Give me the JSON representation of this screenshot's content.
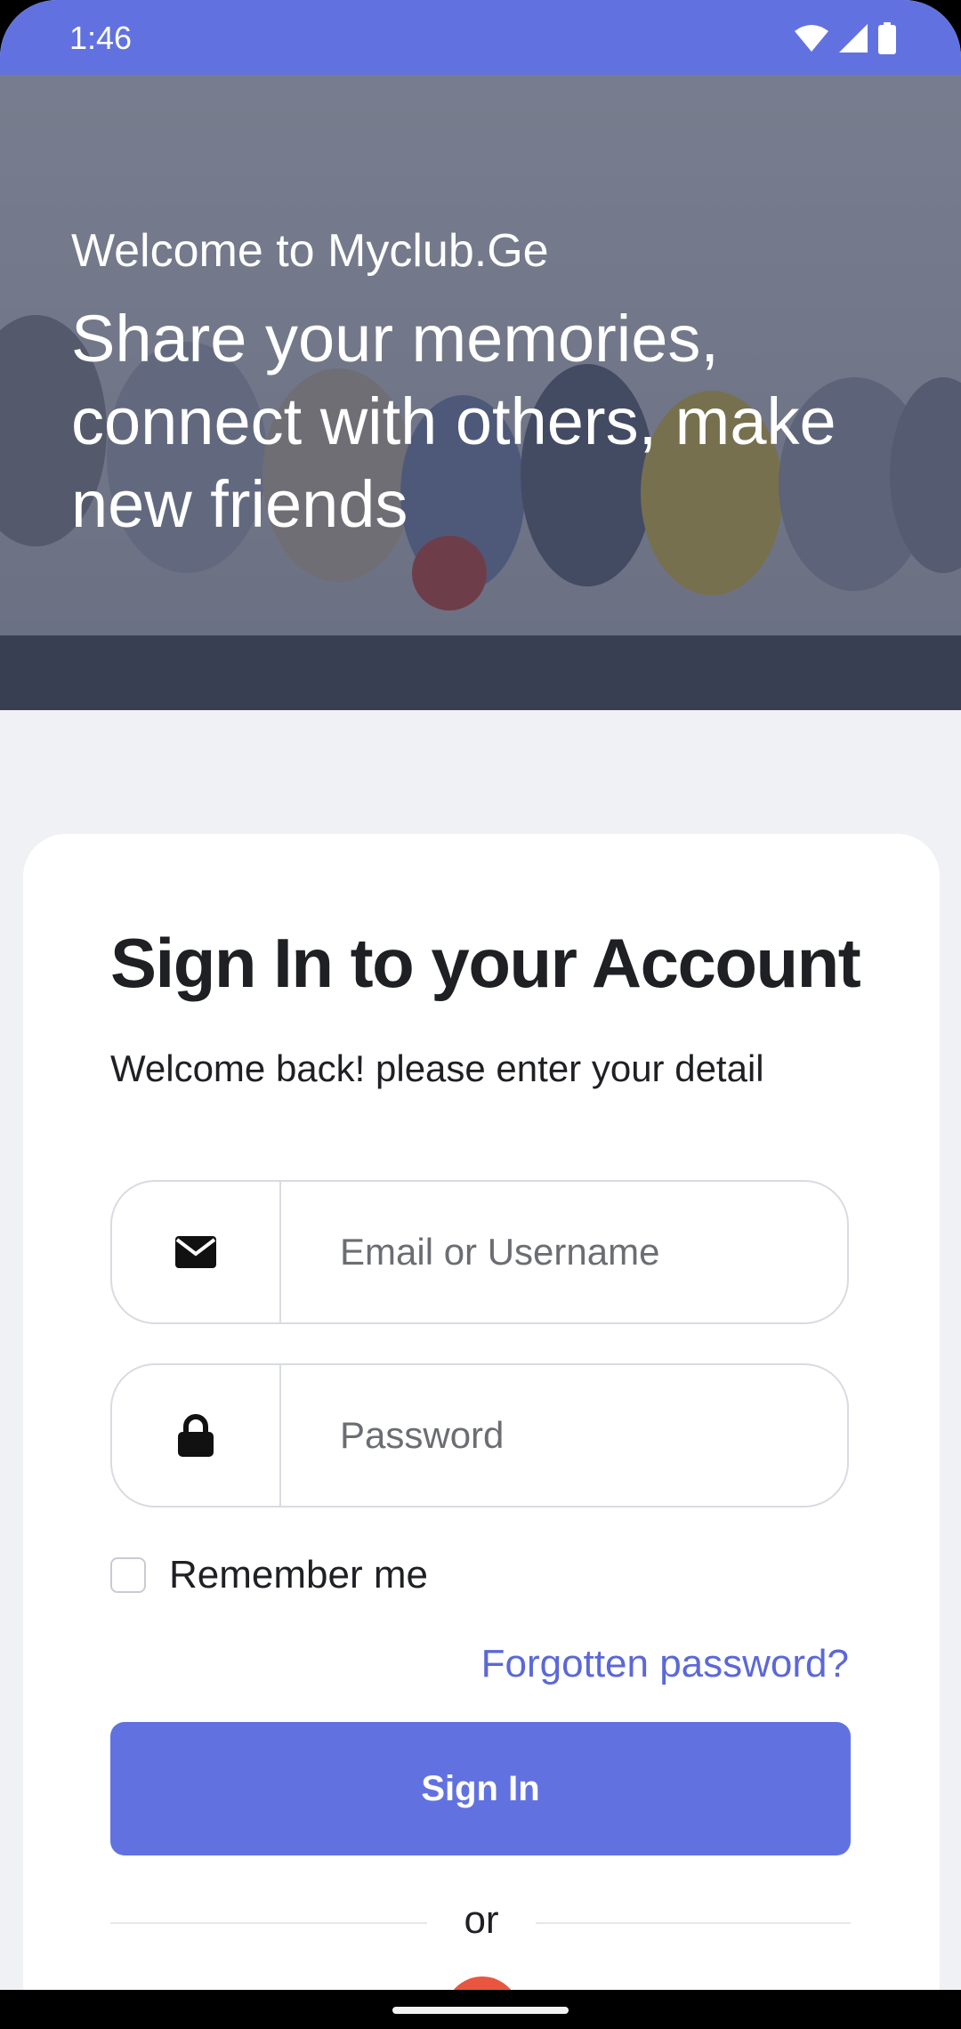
{
  "status_bar": {
    "time": "1:46",
    "icons": [
      "wifi-icon",
      "signal-icon",
      "battery-icon"
    ]
  },
  "hero": {
    "welcome": "Welcome to Myclub.Ge",
    "tagline": "Share your memories, connect with others, make new friends"
  },
  "signin": {
    "title": "Sign In to your Account",
    "subtitle": "Welcome back! please enter your detail",
    "email_placeholder": "Email or Username",
    "password_placeholder": "Password",
    "remember_label": "Remember me",
    "remember_checked": false,
    "forgot_label": "Forgotten password?",
    "button_label": "Sign In",
    "divider_text": "or"
  },
  "colors": {
    "accent": "#6172e0",
    "link": "#5b68d8",
    "background": "#f0f1f5",
    "google": "#e8563f"
  }
}
